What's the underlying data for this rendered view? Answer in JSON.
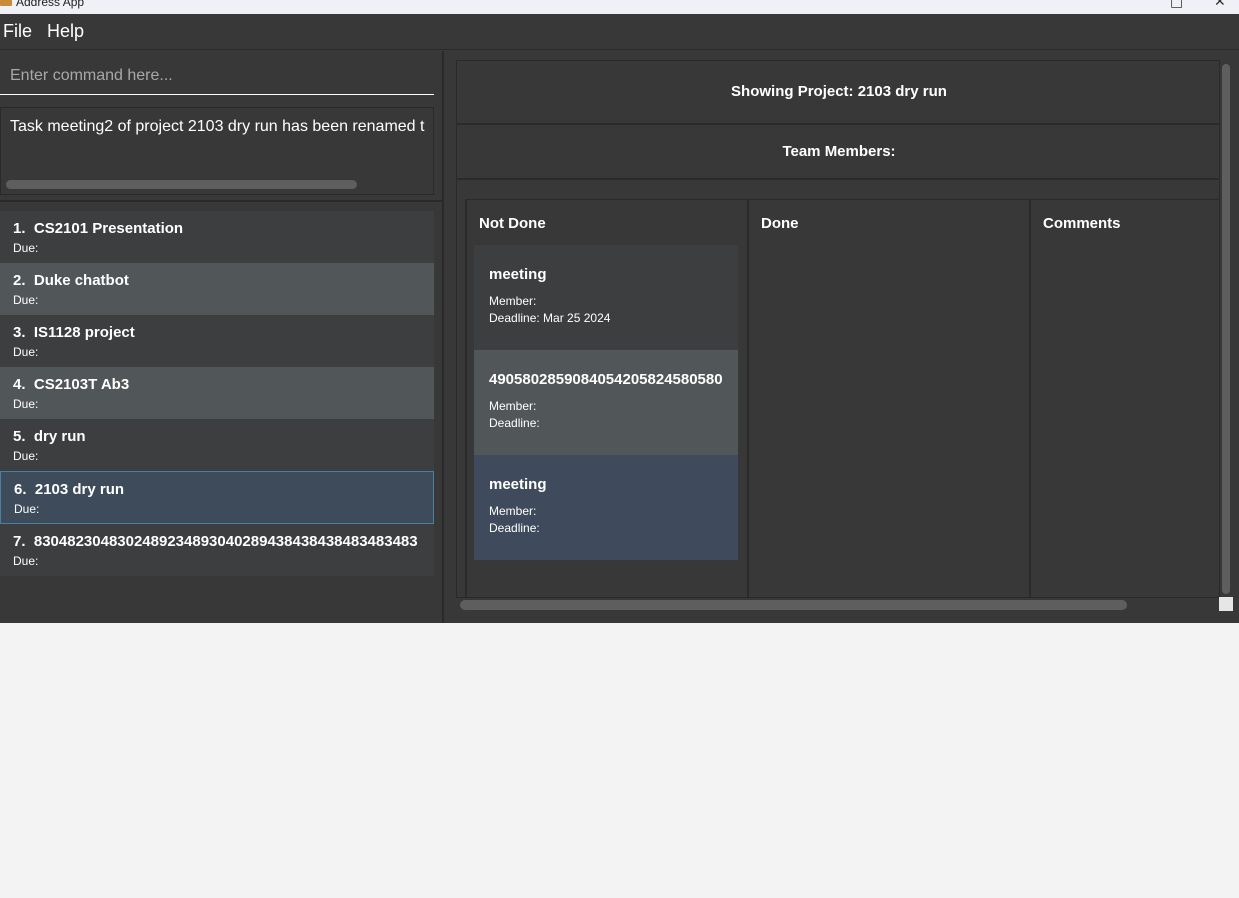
{
  "window": {
    "title": "Address App",
    "controls": [
      "□",
      "✕"
    ]
  },
  "menu": [
    "File",
    "Help"
  ],
  "command": {
    "placeholder": "Enter command here...",
    "value": ""
  },
  "result": {
    "text": "Task meeting2 of project 2103 dry run has been renamed t"
  },
  "projects": [
    {
      "index": "1.",
      "name": "CS2101 Presentation",
      "due": "Due:"
    },
    {
      "index": "2.",
      "name": "Duke chatbot",
      "due": "Due:"
    },
    {
      "index": "3.",
      "name": "IS1128 project",
      "due": "Due:"
    },
    {
      "index": "4.",
      "name": "CS2103T Ab3",
      "due": "Due:"
    },
    {
      "index": "5.",
      "name": "dry run",
      "due": "Due:"
    },
    {
      "index": "6.",
      "name": "2103 dry run",
      "due": "Due:"
    },
    {
      "index": "7.",
      "name": "8304823048302489234893040289438438438483483483",
      "due": "Due:"
    }
  ],
  "detail": {
    "showing": "Showing Project: 2103 dry run",
    "team_members": "Team Members:",
    "columns": [
      "Not Done",
      "Done",
      "Comments"
    ],
    "tasks": [
      {
        "name": "meeting",
        "member": "Member:",
        "deadline": "Deadline: Mar 25 2024"
      },
      {
        "name": "4905802859084054205824580580",
        "member": "Member:",
        "deadline": "Deadline:"
      },
      {
        "name": "meeting",
        "member": "Member:",
        "deadline": "Deadline:"
      }
    ]
  },
  "colors": {
    "background": "#383838",
    "selected": "#3e4b5a",
    "row_alt": "#515658",
    "border": "#2a2a2a"
  }
}
